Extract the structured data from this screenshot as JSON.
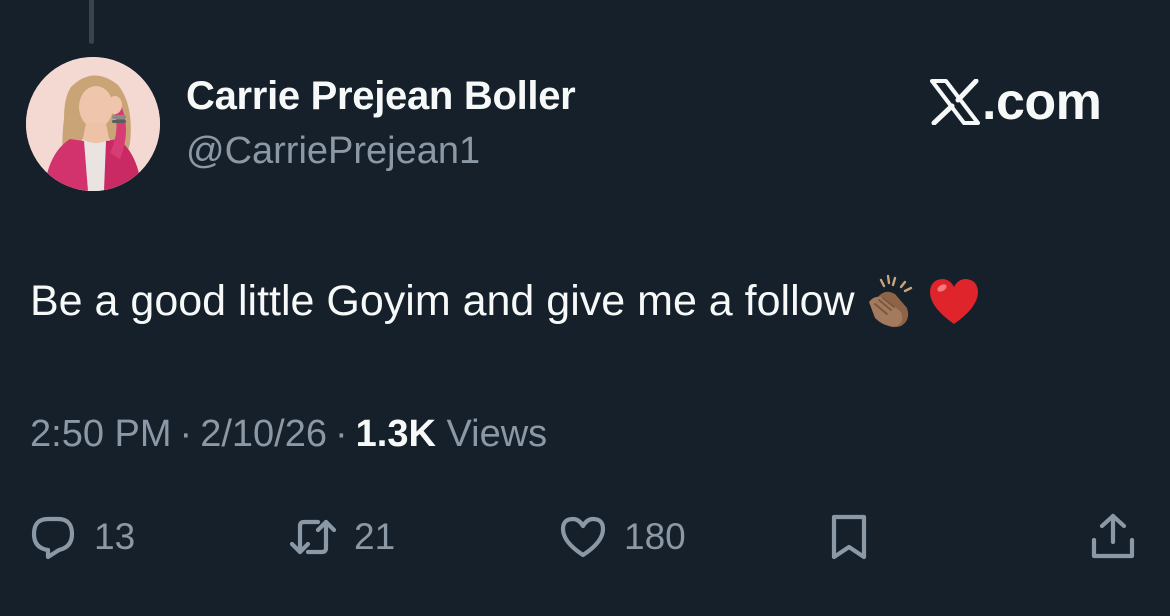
{
  "author": {
    "display_name": "Carrie Prejean Boller",
    "handle": "@CarriePrejean1"
  },
  "brand": {
    "text": ".com",
    "icon": "x-logo-icon"
  },
  "tweet": {
    "text": "Be a good little Goyim and give me a follow",
    "emojis": [
      "clapping-hands-medium-skin-tone",
      "red-heart"
    ]
  },
  "meta": {
    "time": "2:50 PM",
    "date": "2/10/26",
    "separator": "·",
    "views_count": "1.3K",
    "views_label": "Views"
  },
  "actions": {
    "replies": {
      "icon": "reply-icon",
      "count": "13"
    },
    "reposts": {
      "icon": "repost-icon",
      "count": "21"
    },
    "likes": {
      "icon": "heart-icon",
      "count": "180"
    },
    "bookmark": {
      "icon": "bookmark-icon"
    },
    "share": {
      "icon": "share-icon"
    }
  },
  "colors": {
    "background": "#15202b",
    "primary_text": "#f7f9f9",
    "secondary_text": "#8b98a5",
    "heart_emoji": "#e0242c",
    "clap_emoji": "#a47a5e"
  }
}
